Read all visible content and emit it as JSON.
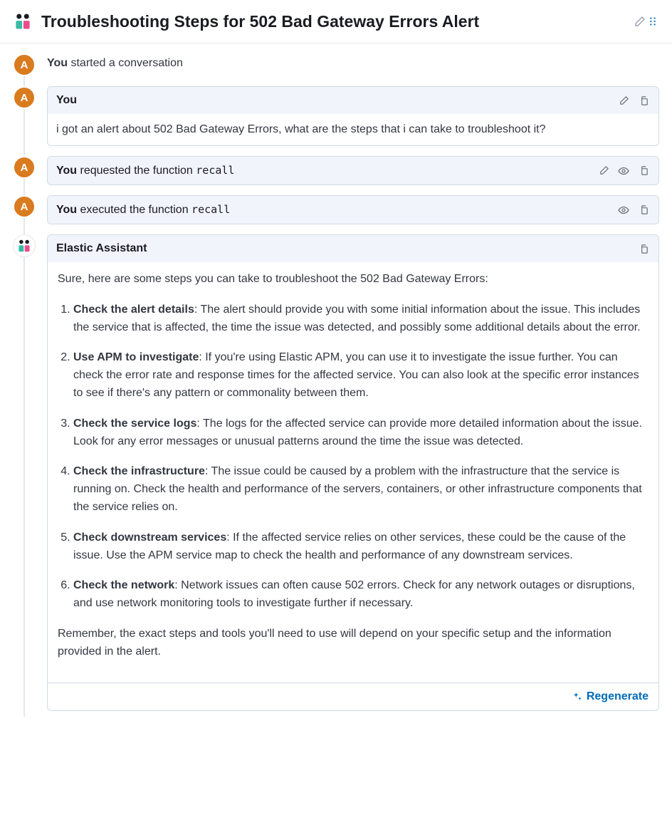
{
  "header": {
    "title": "Troubleshooting Steps for 502 Bad Gateway Errors Alert"
  },
  "user_initial": "A",
  "events": {
    "started": {
      "actor": "You",
      "text": "started a conversation"
    },
    "user_msg": {
      "actor": "You",
      "body": "i got an alert about 502 Bad Gateway Errors, what are the steps that i can take to troubleshoot it?"
    },
    "requested": {
      "actor": "You",
      "text": "requested the function",
      "fn": "recall"
    },
    "executed": {
      "actor": "You",
      "text": "executed the function",
      "fn": "recall"
    },
    "assistant": {
      "name": "Elastic Assistant",
      "intro": "Sure, here are some steps you can take to troubleshoot the 502 Bad Gateway Errors:",
      "steps": [
        {
          "title": "Check the alert details",
          "body": ": The alert should provide you with some initial information about the issue. This includes the service that is affected, the time the issue was detected, and possibly some additional details about the error."
        },
        {
          "title": "Use APM to investigate",
          "body": ": If you're using Elastic APM, you can use it to investigate the issue further. You can check the error rate and response times for the affected service. You can also look at the specific error instances to see if there's any pattern or commonality between them."
        },
        {
          "title": "Check the service logs",
          "body": ": The logs for the affected service can provide more detailed information about the issue. Look for any error messages or unusual patterns around the time the issue was detected."
        },
        {
          "title": "Check the infrastructure",
          "body": ": The issue could be caused by a problem with the infrastructure that the service is running on. Check the health and performance of the servers, containers, or other infrastructure components that the service relies on."
        },
        {
          "title": "Check downstream services",
          "body": ": If the affected service relies on other services, these could be the cause of the issue. Use the APM service map to check the health and performance of any downstream services."
        },
        {
          "title": "Check the network",
          "body": ": Network issues can often cause 502 errors. Check for any network outages or disruptions, and use network monitoring tools to investigate further if necessary."
        }
      ],
      "outro": "Remember, the exact steps and tools you'll need to use will depend on your specific setup and the information provided in the alert."
    }
  },
  "buttons": {
    "regenerate": "Regenerate"
  }
}
